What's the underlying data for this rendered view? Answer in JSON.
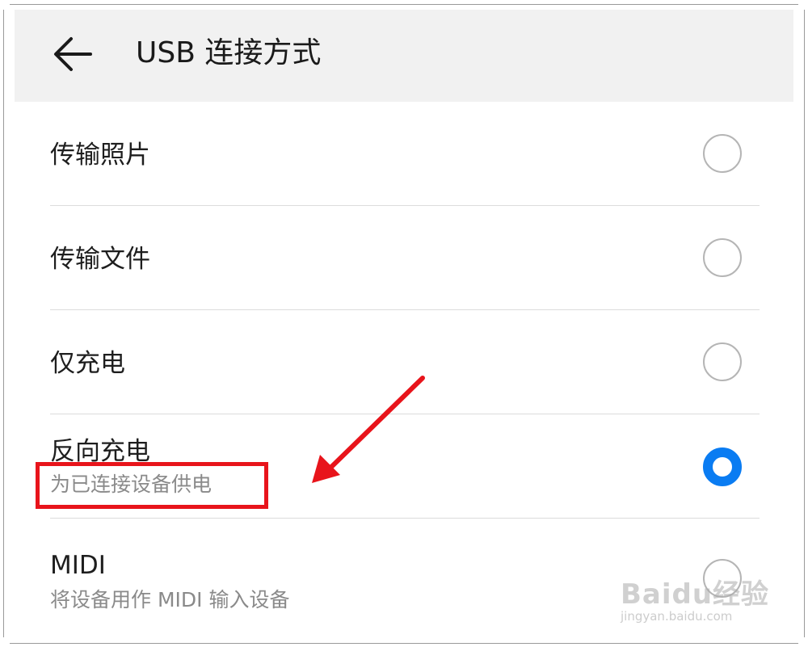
{
  "header": {
    "title": "USB 连接方式",
    "back_icon": "arrow-left-icon"
  },
  "options": [
    {
      "title": "传输照片",
      "subtitle": "",
      "selected": false
    },
    {
      "title": "传输文件",
      "subtitle": "",
      "selected": false
    },
    {
      "title": "仅充电",
      "subtitle": "",
      "selected": false
    },
    {
      "title": "反向充电",
      "subtitle": "为已连接设备供电",
      "selected": true
    },
    {
      "title": "MIDI",
      "subtitle": "将设备用作 MIDI 输入设备",
      "selected": false
    }
  ],
  "colors": {
    "accent": "#0a7cf2",
    "annotation": "#e8141b",
    "header_bg": "#f1f1f1"
  },
  "watermark": {
    "brand": "Baidu经验",
    "url": "jingyan.baidu.com"
  }
}
